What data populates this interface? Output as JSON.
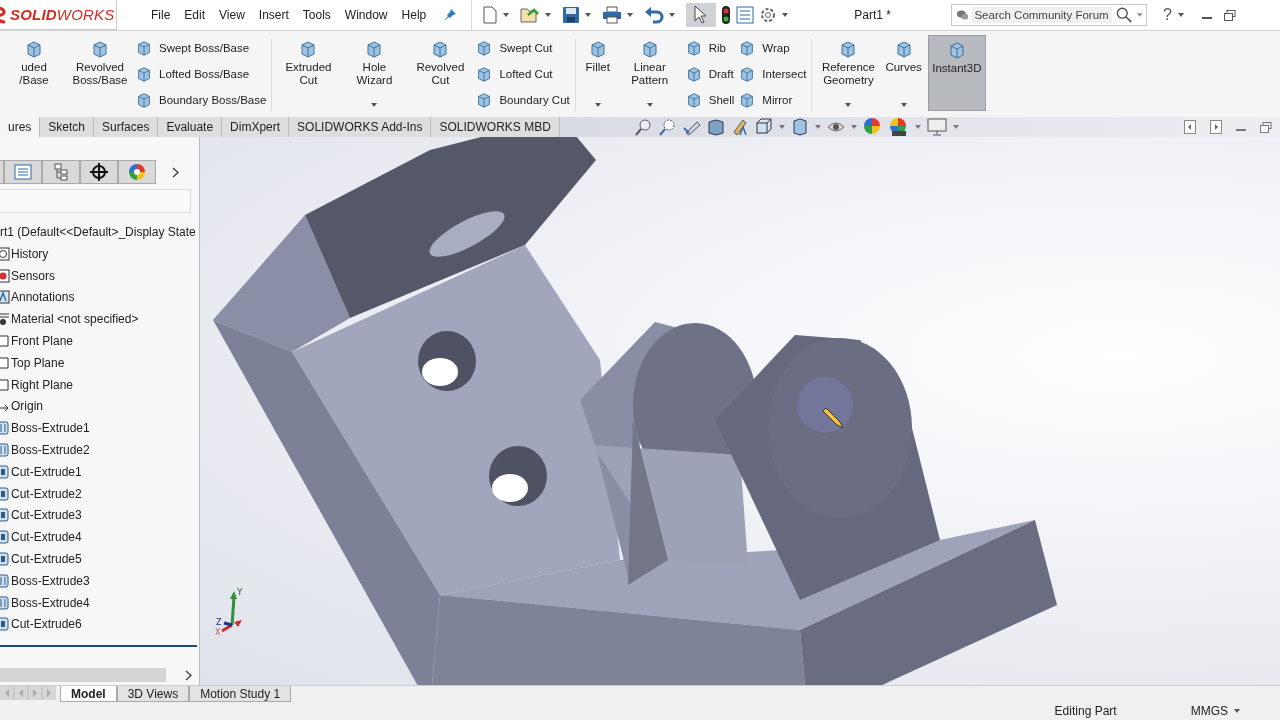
{
  "app": {
    "logo": "**SOLID**WORKS",
    "menu": [
      "File",
      "Edit",
      "View",
      "Insert",
      "Tools",
      "Window",
      "Help"
    ],
    "document_title": "Part1 *",
    "search": {
      "placeholder": "Search Community Forum"
    },
    "help": "?"
  },
  "ribbon": {
    "groups": [
      {
        "items": [
          {
            "kind": "large",
            "label": "uded /Base",
            "dropdown": false,
            "selected": false
          },
          {
            "kind": "large",
            "label": "Revolved Boss/Base",
            "dropdown": false,
            "selected": false
          },
          {
            "kind": "stack",
            "items": [
              "Swept Boss/Base",
              "Lofted Boss/Base",
              "Boundary Boss/Base"
            ]
          }
        ]
      },
      {
        "items": [
          {
            "kind": "large",
            "label": "Extruded Cut",
            "dropdown": false,
            "selected": false
          },
          {
            "kind": "large",
            "label": "Hole Wizard",
            "dropdown": true,
            "selected": false
          },
          {
            "kind": "large",
            "label": "Revolved Cut",
            "dropdown": false,
            "selected": false
          },
          {
            "kind": "stack",
            "items": [
              "Swept Cut",
              "Lofted Cut",
              "Boundary Cut"
            ]
          }
        ]
      },
      {
        "items": [
          {
            "kind": "large",
            "label": "Fillet",
            "dropdown": true,
            "selected": false
          },
          {
            "kind": "large",
            "label": "Linear Pattern",
            "dropdown": true,
            "selected": false
          },
          {
            "kind": "stack",
            "items": [
              "Rib",
              "Draft",
              "Shell"
            ]
          },
          {
            "kind": "stack",
            "items": [
              "Wrap",
              "Intersect",
              "Mirror"
            ]
          }
        ]
      },
      {
        "items": [
          {
            "kind": "large",
            "label": "Reference Geometry",
            "dropdown": true,
            "selected": false
          },
          {
            "kind": "large",
            "label": "Curves",
            "dropdown": true,
            "selected": false
          },
          {
            "kind": "large",
            "label": "Instant3D",
            "dropdown": false,
            "selected": true
          }
        ]
      }
    ]
  },
  "tabs": [
    {
      "label": "ures",
      "selected": true
    },
    {
      "label": "Sketch",
      "selected": false
    },
    {
      "label": "Surfaces",
      "selected": false
    },
    {
      "label": "Evaluate",
      "selected": false
    },
    {
      "label": "DimXpert",
      "selected": false
    },
    {
      "label": "SOLIDWORKS Add-Ins",
      "selected": false
    },
    {
      "label": "SOLIDWORKS MBD",
      "selected": false
    }
  ],
  "tree": {
    "root": {
      "label": "rt1  (Default<<Default>_Display State",
      "children": [
        {
          "label": "History",
          "kind": "history"
        },
        {
          "label": "Sensors",
          "kind": "sensors"
        },
        {
          "label": "Annotations",
          "kind": "annotations"
        },
        {
          "label": "Material <not specified>",
          "kind": "material"
        },
        {
          "label": "Front Plane",
          "kind": "plane"
        },
        {
          "label": "Top Plane",
          "kind": "plane"
        },
        {
          "label": "Right Plane",
          "kind": "plane"
        },
        {
          "label": "Origin",
          "kind": "origin"
        },
        {
          "label": "Boss-Extrude1",
          "kind": "boss"
        },
        {
          "label": "Boss-Extrude2",
          "kind": "boss"
        },
        {
          "label": "Cut-Extrude1",
          "kind": "cut"
        },
        {
          "label": "Cut-Extrude2",
          "kind": "cut"
        },
        {
          "label": "Cut-Extrude3",
          "kind": "cut"
        },
        {
          "label": "Cut-Extrude4",
          "kind": "cut"
        },
        {
          "label": "Cut-Extrude5",
          "kind": "cut"
        },
        {
          "label": "Boss-Extrude3",
          "kind": "boss"
        },
        {
          "label": "Boss-Extrude4",
          "kind": "boss"
        },
        {
          "label": "Cut-Extrude6",
          "kind": "cut"
        }
      ]
    }
  },
  "triad": {
    "axes": [
      "Y",
      "Z",
      "X"
    ]
  },
  "bottom_tabs": [
    {
      "label": "Model",
      "selected": true
    },
    {
      "label": "3D Views",
      "selected": false
    },
    {
      "label": "Motion Study 1",
      "selected": false
    }
  ],
  "status_bar": {
    "mode": "Editing Part",
    "units": "MMGS"
  }
}
